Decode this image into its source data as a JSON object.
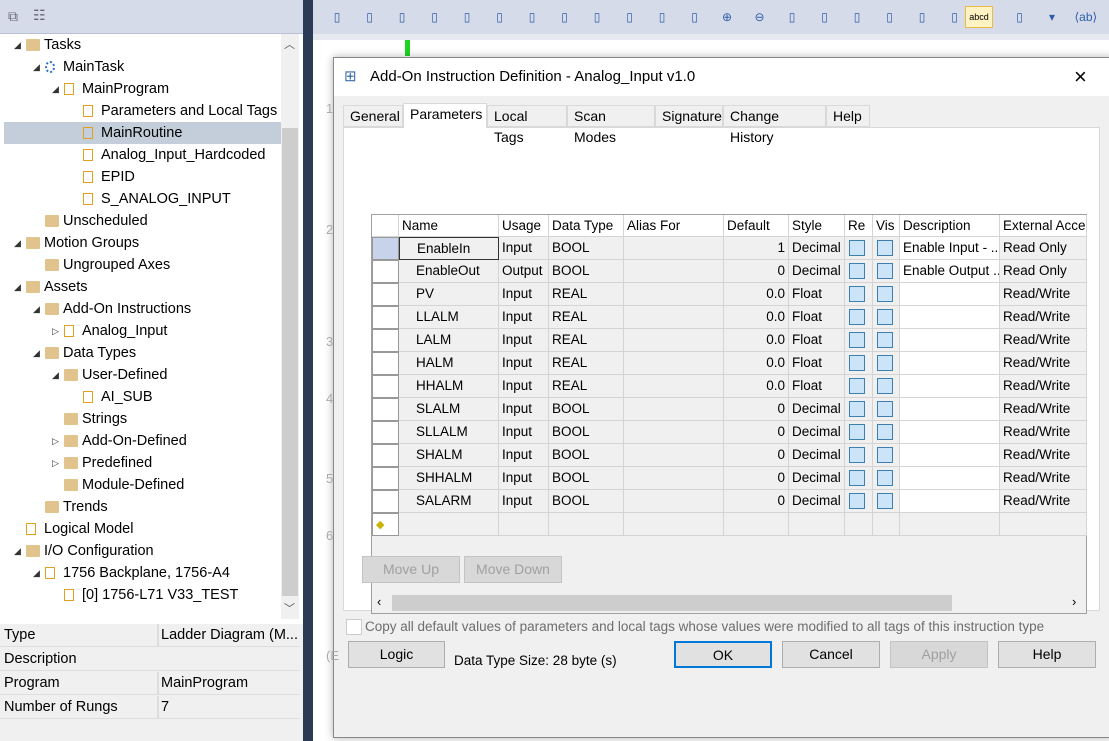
{
  "toolbar": {
    "icons": [
      "rung-icon",
      "branch-icon",
      "branch-level-icon",
      "xic-icon",
      "xio-icon",
      "verify-icon",
      "unverify-icon",
      "test-edits-icon",
      "untest-edits-icon",
      "accept-icon",
      "cancel-edits-icon",
      "finalize-icon",
      "zoom-in-icon",
      "zoom-out-icon",
      "crossref-icon",
      "go-to-icon",
      "bookmark-icon",
      "delete-bookmark-icon",
      "properties-icon",
      "tag-description-icon",
      "wrap-icon",
      "abbrev-icon",
      "more-icon",
      "ab-icon"
    ],
    "abcd_label": "abcd"
  },
  "tree": [
    {
      "label": "Tasks",
      "level": 0,
      "exp": "open",
      "icon": "folder"
    },
    {
      "label": "MainTask",
      "level": 1,
      "exp": "open",
      "icon": "task"
    },
    {
      "label": "MainProgram",
      "level": 2,
      "exp": "open",
      "icon": "program"
    },
    {
      "label": "Parameters and Local Tags",
      "level": 3,
      "icon": "tag"
    },
    {
      "label": "MainRoutine",
      "level": 3,
      "icon": "main-routine",
      "selected": true
    },
    {
      "label": "Analog_Input_Hardcoded",
      "level": 3,
      "icon": "ladder"
    },
    {
      "label": "EPID",
      "level": 3,
      "icon": "fbd"
    },
    {
      "label": "S_ANALOG_INPUT",
      "level": 3,
      "icon": "ladder"
    },
    {
      "label": "Unscheduled",
      "level": 1,
      "icon": "folder"
    },
    {
      "label": "Motion Groups",
      "level": 0,
      "exp": "open",
      "icon": "folder"
    },
    {
      "label": "Ungrouped Axes",
      "level": 1,
      "icon": "folder"
    },
    {
      "label": "Assets",
      "level": 0,
      "exp": "open",
      "icon": "folder"
    },
    {
      "label": "Add-On Instructions",
      "level": 1,
      "exp": "open",
      "icon": "folder"
    },
    {
      "label": "Analog_Input",
      "level": 2,
      "exp": "closed",
      "icon": "aoi"
    },
    {
      "label": "Data Types",
      "level": 1,
      "exp": "open",
      "icon": "folder"
    },
    {
      "label": "User-Defined",
      "level": 2,
      "exp": "open",
      "icon": "datatype-folder"
    },
    {
      "label": "AI_SUB",
      "level": 3,
      "icon": "datatype"
    },
    {
      "label": "Strings",
      "level": 2,
      "icon": "datatype-folder"
    },
    {
      "label": "Add-On-Defined",
      "level": 2,
      "exp": "closed",
      "icon": "datatype-folder"
    },
    {
      "label": "Predefined",
      "level": 2,
      "exp": "closed",
      "icon": "datatype-folder"
    },
    {
      "label": "Module-Defined",
      "level": 2,
      "icon": "datatype-folder"
    },
    {
      "label": "Trends",
      "level": 1,
      "icon": "folder"
    },
    {
      "label": "Logical Model",
      "level": 0,
      "icon": "logical-model"
    },
    {
      "label": "I/O Configuration",
      "level": 0,
      "exp": "open",
      "icon": "folder"
    },
    {
      "label": "1756 Backplane, 1756-A4",
      "level": 1,
      "exp": "open",
      "icon": "backplane"
    },
    {
      "label": "[0] 1756-L71 V33_TEST",
      "level": 2,
      "icon": "controller"
    }
  ],
  "properties": [
    {
      "name": "Type",
      "value": "Ladder Diagram (M..."
    },
    {
      "name": "Description",
      "value": ""
    },
    {
      "name": "Program",
      "value": "MainProgram"
    },
    {
      "name": "Number of Rungs",
      "value": "7"
    }
  ],
  "ladder": {
    "rungs": [
      "1",
      "2",
      "3",
      "4",
      "5",
      "6",
      "(E"
    ]
  },
  "dialog": {
    "title": "Add-On Instruction Definition - Analog_Input v1.0",
    "tabs": [
      "General",
      "Parameters",
      "Local Tags",
      "Scan Modes",
      "Signature",
      "Change History",
      "Help"
    ],
    "active_tab": "Parameters",
    "columns": [
      "",
      "Name",
      "Usage",
      "Data Type",
      "Alias For",
      "Default",
      "Style",
      "Re",
      "Vis",
      "Description",
      "External Acce"
    ],
    "rows": [
      [
        "EnableIn",
        "Input",
        "BOOL",
        "",
        "1",
        "Decimal",
        "Enable Input - ...",
        "Read Only"
      ],
      [
        "EnableOut",
        "Output",
        "BOOL",
        "",
        "0",
        "Decimal",
        "Enable Output ...",
        "Read Only"
      ],
      [
        "PV",
        "Input",
        "REAL",
        "",
        "0.0",
        "Float",
        "",
        "Read/Write"
      ],
      [
        "LLALM",
        "Input",
        "REAL",
        "",
        "0.0",
        "Float",
        "",
        "Read/Write"
      ],
      [
        "LALM",
        "Input",
        "REAL",
        "",
        "0.0",
        "Float",
        "",
        "Read/Write"
      ],
      [
        "HALM",
        "Input",
        "REAL",
        "",
        "0.0",
        "Float",
        "",
        "Read/Write"
      ],
      [
        "HHALM",
        "Input",
        "REAL",
        "",
        "0.0",
        "Float",
        "",
        "Read/Write"
      ],
      [
        "SLALM",
        "Input",
        "BOOL",
        "",
        "0",
        "Decimal",
        "",
        "Read/Write"
      ],
      [
        "SLLALM",
        "Input",
        "BOOL",
        "",
        "0",
        "Decimal",
        "",
        "Read/Write"
      ],
      [
        "SHALM",
        "Input",
        "BOOL",
        "",
        "0",
        "Decimal",
        "",
        "Read/Write"
      ],
      [
        "SHHALM",
        "Input",
        "BOOL",
        "",
        "0",
        "Decimal",
        "",
        "Read/Write"
      ],
      [
        "SALARM",
        "Input",
        "BOOL",
        "",
        "0",
        "Decimal",
        "",
        "Read/Write"
      ]
    ],
    "move_up": "Move Up",
    "move_down": "Move Down",
    "copy_defaults_label": "Copy all default values of parameters and local tags whose values were modified to all tags of this instruction type",
    "logic": "Logic",
    "data_type_size": "Data Type Size: 28 byte (s)",
    "ok": "OK",
    "cancel": "Cancel",
    "apply": "Apply",
    "help": "Help",
    "close_icon": "×"
  }
}
